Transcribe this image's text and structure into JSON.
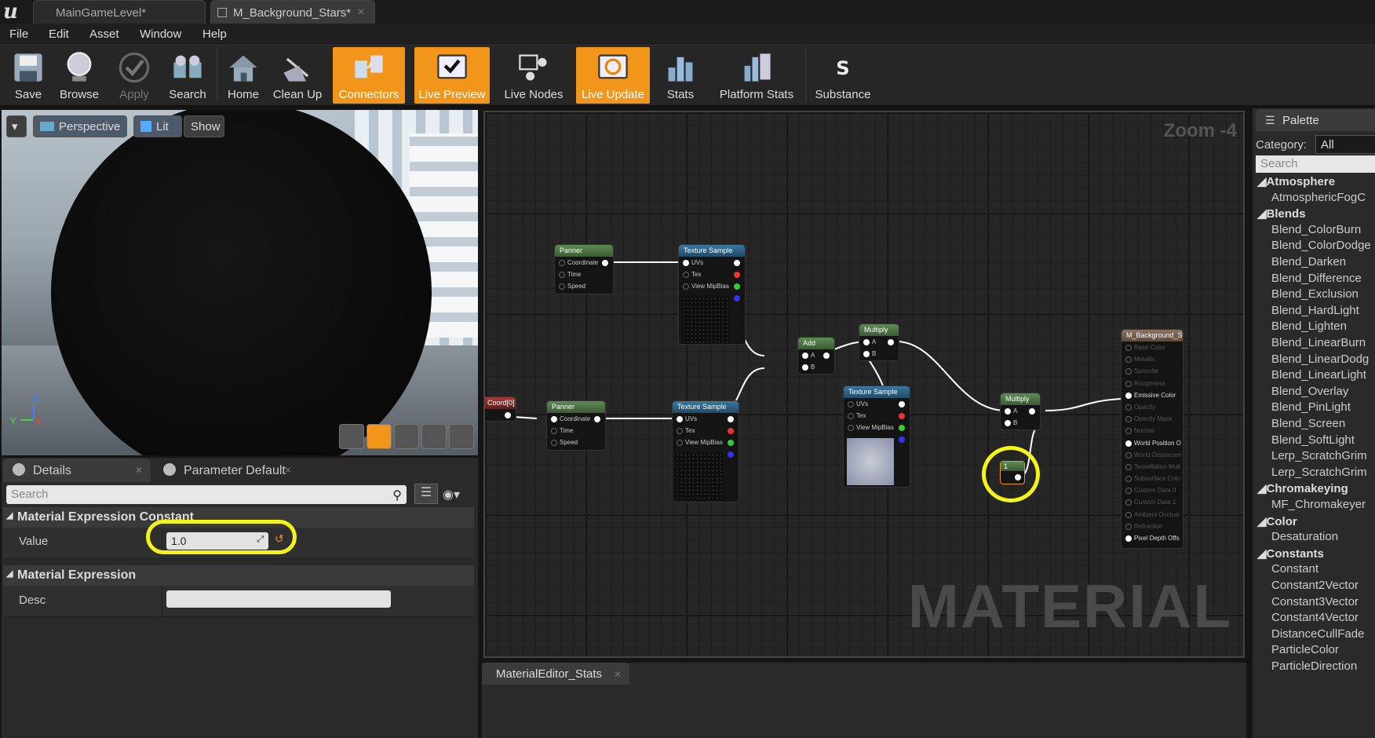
{
  "tabs": [
    {
      "label": "MainGameLevel*"
    },
    {
      "label": "M_Background_Stars*"
    }
  ],
  "menu": [
    "File",
    "Edit",
    "Asset",
    "Window",
    "Help"
  ],
  "toolbar": {
    "save": "Save",
    "browse": "Browse",
    "apply": "Apply",
    "search": "Search",
    "home": "Home",
    "cleanup": "Clean Up",
    "connectors": "Connectors",
    "live_preview": "Live Preview",
    "live_nodes": "Live Nodes",
    "live_update": "Live Update",
    "stats": "Stats",
    "platform_stats": "Platform Stats",
    "substance": "Substance"
  },
  "toolbar_active": [
    "Connectors",
    "Live Preview",
    "Live Update"
  ],
  "viewport": {
    "perspective": "Perspective",
    "lit": "Lit",
    "show": "Show",
    "axis_z": "Z",
    "axis_y": "Y",
    "axis_x": "X"
  },
  "details": {
    "tab_details": "Details",
    "tab_params": "Parameter Default",
    "search_placeholder": "Search",
    "section1": "Material Expression Constant",
    "value_label": "Value",
    "value": "1.0",
    "section2": "Material Expression",
    "desc_label": "Desc",
    "desc": ""
  },
  "graph": {
    "zoom": "Zoom -4",
    "watermark": "MATERIAL",
    "panner_title": "Panner",
    "panner_pins": [
      "Coordinate",
      "Time",
      "Speed"
    ],
    "tex_title": "Texture Sample",
    "tex_pins": [
      "UVs",
      "Tex",
      "View MipBias"
    ],
    "add_title": "Add",
    "multiply_title": "Multiply",
    "pin_a": "A",
    "pin_b": "B",
    "texcoord_title": "Coord[0]",
    "const_title": "1",
    "result_title": "M_Background_Sta",
    "result_pins": [
      "Base Color",
      "Metallic",
      "Specular",
      "Roughness",
      "Emissive Color",
      "Opacity",
      "Opacity Mask",
      "Normal",
      "World Position O",
      "World Displacem",
      "Tessellation Mult",
      "Subsurface Colo",
      "Custom Data 0",
      "Custom Data 1",
      "Ambient Occlusi",
      "Refraction",
      "Pixel Depth Offs"
    ]
  },
  "stats_tab": "MaterialEditor_Stats",
  "palette": {
    "title": "Palette",
    "category_label": "Category:",
    "category_value": "All",
    "search_placeholder": "Search",
    "groups": [
      {
        "name": "Atmosphere",
        "items": [
          "AtmosphericFogC"
        ]
      },
      {
        "name": "Blends",
        "items": [
          "Blend_ColorBurn",
          "Blend_ColorDodge",
          "Blend_Darken",
          "Blend_Difference",
          "Blend_Exclusion",
          "Blend_HardLight",
          "Blend_Lighten",
          "Blend_LinearBurn",
          "Blend_LinearDodg",
          "Blend_LinearLight",
          "Blend_Overlay",
          "Blend_PinLight",
          "Blend_Screen",
          "Blend_SoftLight",
          "Lerp_ScratchGrim",
          "Lerp_ScratchGrim"
        ]
      },
      {
        "name": "Chromakeying",
        "items": [
          "MF_Chromakeyer"
        ]
      },
      {
        "name": "Color",
        "items": [
          "Desaturation"
        ]
      },
      {
        "name": "Constants",
        "items": [
          "Constant",
          "Constant2Vector",
          "Constant3Vector",
          "Constant4Vector",
          "DistanceCullFade",
          "ParticleColor",
          "ParticleDirection"
        ]
      }
    ]
  },
  "colors": {
    "accent": "#f2961b",
    "highlight": "#f4f41a"
  }
}
